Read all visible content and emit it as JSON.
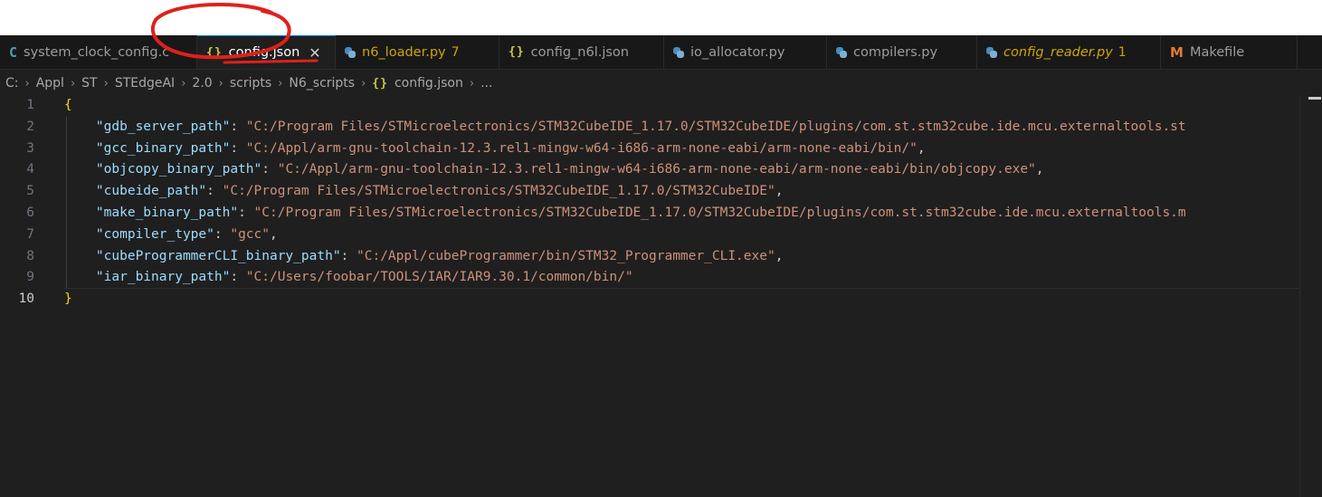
{
  "tabs": [
    {
      "icon": "C",
      "label": "system_clock_config.c",
      "style": "normal"
    },
    {
      "icon": "{}",
      "label": "config.json",
      "style": "active",
      "close": "✕"
    },
    {
      "icon": "py",
      "label": "n6_loader.py",
      "style": "modified",
      "badge": "7"
    },
    {
      "icon": "{}",
      "label": "config_n6l.json",
      "style": "normal"
    },
    {
      "icon": "py",
      "label": "io_allocator.py",
      "style": "normal"
    },
    {
      "icon": "py",
      "label": "compilers.py",
      "style": "normal"
    },
    {
      "icon": "py",
      "label": "config_reader.py",
      "style": "modified-italic",
      "badge": "1"
    },
    {
      "icon": "M",
      "label": "Makefile",
      "style": "normal"
    }
  ],
  "breadcrumb": {
    "items": [
      "C:",
      "Appl",
      "ST",
      "STEdgeAI",
      "2.0",
      "scripts",
      "N6_scripts"
    ],
    "file_icon": "{}",
    "file": "config.json",
    "more": "..."
  },
  "editor": {
    "line_numbers": [
      "1",
      "2",
      "3",
      "4",
      "5",
      "6",
      "7",
      "8",
      "9",
      "10"
    ],
    "current_line": "10",
    "open_brace": "{",
    "close_brace": "}",
    "entries": [
      {
        "key": "\"gdb_server_path\"",
        "value": "\"C:/Program Files/STMicroelectronics/STM32CubeIDE_1.17.0/STM32CubeIDE/plugins/com.st.stm32cube.ide.mcu.externaltools.st",
        "comma": ""
      },
      {
        "key": "\"gcc_binary_path\"",
        "value": "\"C:/Appl/arm-gnu-toolchain-12.3.rel1-mingw-w64-i686-arm-none-eabi/arm-none-eabi/bin/\"",
        "comma": ","
      },
      {
        "key": "\"objcopy_binary_path\"",
        "value": "\"C:/Appl/arm-gnu-toolchain-12.3.rel1-mingw-w64-i686-arm-none-eabi/arm-none-eabi/bin/objcopy.exe\"",
        "comma": ","
      },
      {
        "key": "\"cubeide_path\"",
        "value": "\"C:/Program Files/STMicroelectronics/STM32CubeIDE_1.17.0/STM32CubeIDE\"",
        "comma": ","
      },
      {
        "key": "\"make_binary_path\"",
        "value": "\"C:/Program Files/STMicroelectronics/STM32CubeIDE_1.17.0/STM32CubeIDE/plugins/com.st.stm32cube.ide.mcu.externaltools.m",
        "comma": ""
      },
      {
        "key": "\"compiler_type\"",
        "value": "\"gcc\"",
        "comma": ","
      },
      {
        "key": "\"cubeProgrammerCLI_binary_path\"",
        "value": "\"C:/Appl/cubeProgrammer/bin/STM32_Programmer_CLI.exe\"",
        "comma": ","
      },
      {
        "key": "\"iar_binary_path\"",
        "value": "\"C:/Users/foobar/TOOLS/IAR/IAR9.30.1/common/bin/\"",
        "comma": ""
      }
    ]
  },
  "colors": {
    "annotation": "#e0201c",
    "active_tab_border": "#0078d4",
    "json_key": "#9cdcfe",
    "json_string": "#ce9178",
    "brace": "#ffd700"
  }
}
